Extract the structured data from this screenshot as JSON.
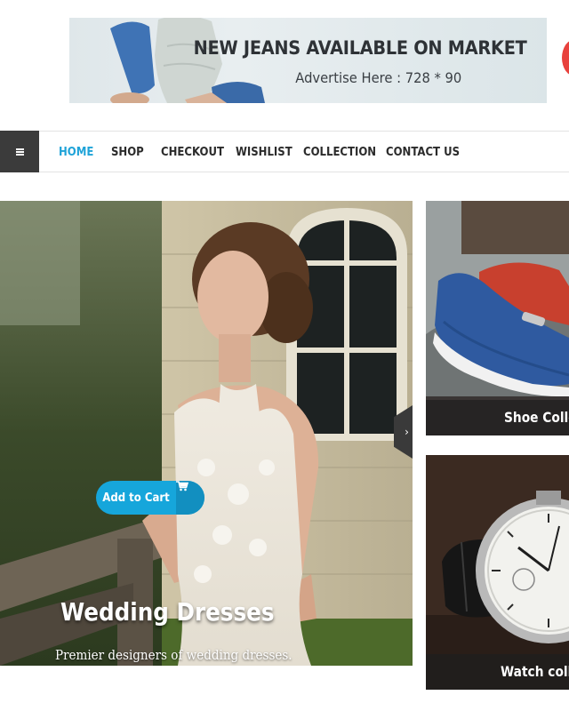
{
  "banner": {
    "title": "NEW JEANS AVAILABLE ON MARKET",
    "subtitle": "Advertise Here : 728 * 90"
  },
  "nav": {
    "items": [
      {
        "label": "HOME",
        "active": true
      },
      {
        "label": "SHOP",
        "active": false
      },
      {
        "label": "CHECKOUT",
        "active": false
      },
      {
        "label": "WISHLIST",
        "active": false
      },
      {
        "label": "COLLECTION",
        "active": false
      },
      {
        "label": "CONTACT US",
        "active": false
      }
    ],
    "active_color": "#1fa3d8"
  },
  "hero": {
    "title": "Wedding Dresses",
    "subtitle": "Premier designers of wedding dresses.",
    "button_label": "Add to Cart",
    "button_color": "#16a6db"
  },
  "tiles": {
    "shoe_caption": "Shoe Collection",
    "watch_caption": "Watch collection"
  },
  "icons": [
    "menu-icon",
    "cart-icon",
    "chevron-right-icon"
  ]
}
